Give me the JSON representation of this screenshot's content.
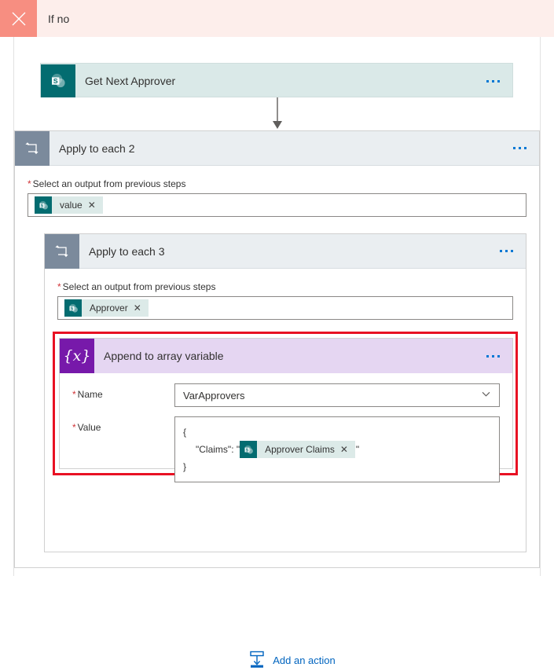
{
  "branch": {
    "label": "If no",
    "close_icon": "close-icon",
    "header_bg": "#fdeeeb",
    "close_bg": "#f78e81"
  },
  "actions": {
    "get_next_approver": {
      "title": "Get Next Approver",
      "icon": "sharepoint-icon",
      "overflow_label": "•••",
      "bg": "#dae9e8"
    },
    "apply_to_each_2": {
      "title": "Apply to each 2",
      "icon": "loop-icon",
      "field_label": "Select an output from previous steps",
      "required_marker": "*",
      "token": {
        "text": "value",
        "icon": "sharepoint-icon",
        "remove": "✕"
      },
      "header_bg": "#eaeef1",
      "icon_bg": "#7b8a9c"
    },
    "apply_to_each_3": {
      "title": "Apply to each 3",
      "icon": "loop-icon",
      "field_label": "Select an output from previous steps",
      "required_marker": "*",
      "token": {
        "text": "Approver",
        "icon": "sharepoint-icon",
        "remove": "✕"
      },
      "header_bg": "#eaeef1",
      "icon_bg": "#7b8a9c"
    },
    "append_to_array_variable": {
      "title": "Append to array variable",
      "icon": "variable-braces-icon",
      "icon_glyph": "{x}",
      "header_bg": "#e5d6f2",
      "icon_bg": "#7719aa",
      "highlight_color": "#e81123",
      "name_field": {
        "label": "Name",
        "required_marker": "*",
        "value": "VarApprovers",
        "chevron": "chevron-down-icon"
      },
      "value_field": {
        "label": "Value",
        "required_marker": "*",
        "line1": "{",
        "line2_prefix": "\"Claims\": \"",
        "line2_suffix": "\"",
        "line3": "}",
        "token": {
          "text": "Approver Claims",
          "icon": "sharepoint-icon",
          "remove": "✕"
        }
      }
    }
  },
  "add_action": {
    "label": "Add an action",
    "icon": "add-action-icon",
    "color": "#0064bf"
  }
}
